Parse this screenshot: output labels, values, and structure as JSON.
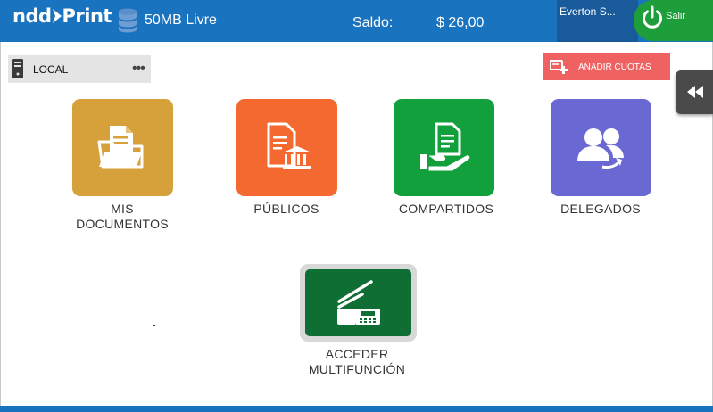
{
  "header": {
    "logo_prefix": "ndd",
    "logo_suffix": "Print",
    "storage": "50MB Livre",
    "balance_label": "Saldo:",
    "balance_value": "$ 26,00",
    "user": "Everton S...",
    "logout": "Salir"
  },
  "location": {
    "label": "LOCAL",
    "more": "•••"
  },
  "add_quota": {
    "label": "AÑADIR CUOTAS"
  },
  "tiles": [
    {
      "label": "MIS\nDOCUMENTOS",
      "color": "#d6a03a",
      "icon": "folder-document-icon"
    },
    {
      "label": "PÚBLICOS",
      "color": "#f3692f",
      "icon": "public-document-icon"
    },
    {
      "label": "COMPARTIDOS",
      "color": "#12a03c",
      "icon": "shared-document-icon"
    },
    {
      "label": "DELEGADOS",
      "color": "#6a68d3",
      "icon": "delegated-users-icon"
    }
  ],
  "multifunction": {
    "label": "ACCEDER\nMULTIFUNCIÓN",
    "color": "#0f6e33",
    "icon": "scanner-icon"
  },
  "colors": {
    "header": "#1a73be",
    "user_box": "#195a9a",
    "logout": "#1e9e3a",
    "add_quota": "#f06262",
    "side_tab": "#4a4a4a"
  }
}
